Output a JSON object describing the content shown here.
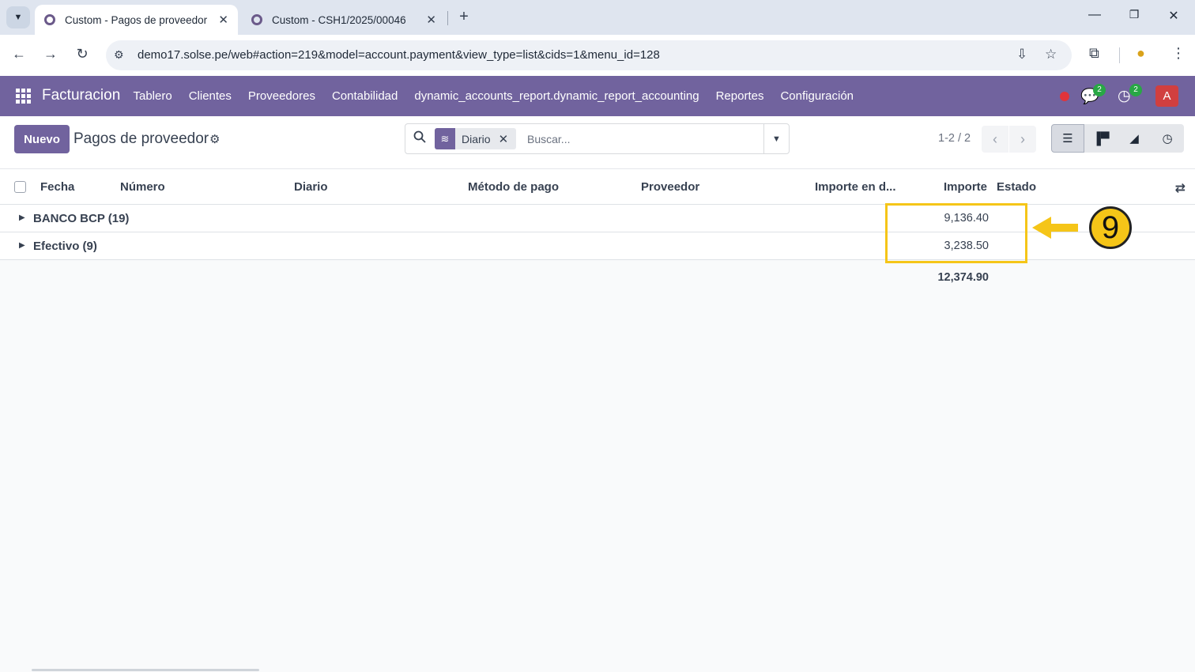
{
  "browser": {
    "tabs": [
      {
        "title": "Custom - Pagos de proveedor",
        "active": true
      },
      {
        "title": "Custom - CSH1/2025/00046",
        "active": false
      }
    ],
    "url": "demo17.solse.pe/web#action=219&model=account.payment&view_type=list&cids=1&menu_id=128",
    "icons": {
      "tab_list": "chevron-down-icon",
      "new_tab": "plus-icon",
      "back": "arrow-left-icon",
      "forward": "arrow-right-icon",
      "reload": "reload-icon",
      "site_info": "tune-icon",
      "install": "install-icon",
      "bookmark": "star-icon",
      "extensions": "puzzle-icon",
      "profile": "profile-icon",
      "menu": "kebab-icon"
    }
  },
  "odoo": {
    "app_name": "Facturacion",
    "menu": [
      "Tablero",
      "Clientes",
      "Proveedores",
      "Contabilidad",
      "dynamic_accounts_report.dynamic_report_accounting",
      "Reportes",
      "Configuración"
    ],
    "systray": {
      "messages_badge": "2",
      "activities_badge": "2",
      "avatar_letter": "A"
    },
    "colors": {
      "brand": "#71639e",
      "highlight": "#f5c518",
      "status_dot": "#e0343b",
      "badge": "#28a745"
    }
  },
  "control_panel": {
    "new_button": "Nuevo",
    "title": "Pagos de proveedor",
    "facet_value": "Diario",
    "search_placeholder": "Buscar...",
    "pager": "1-2 / 2"
  },
  "list": {
    "columns": [
      "Fecha",
      "Número",
      "Diario",
      "Método de pago",
      "Proveedor",
      "Importe en d...",
      "Importe",
      "Estado"
    ],
    "groups": [
      {
        "name": "BANCO BCP (19)",
        "amount": "9,136.40"
      },
      {
        "name": "Efectivo (9)",
        "amount": "3,238.50"
      }
    ],
    "total": "12,374.90"
  },
  "annotation": {
    "step_number": "9"
  }
}
